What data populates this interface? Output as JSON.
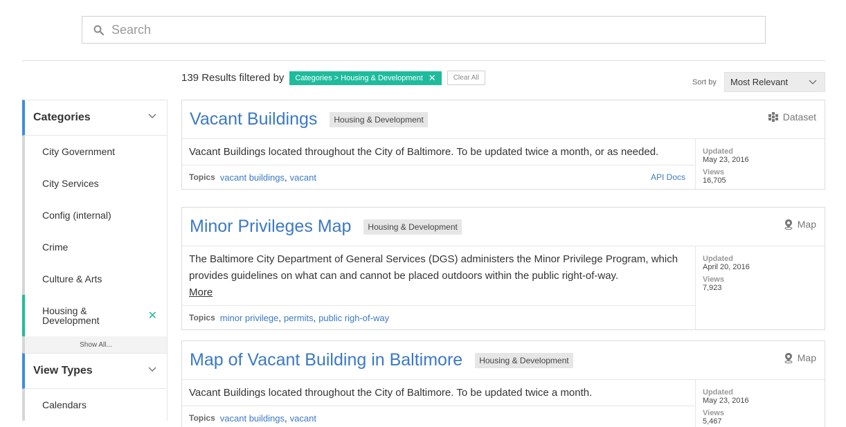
{
  "search": {
    "placeholder": "Search"
  },
  "results": {
    "count_text": "139 Results filtered by",
    "filter_chip": "Categories > Housing & Development",
    "clear_all": "Clear All"
  },
  "sort": {
    "label": "Sort by",
    "selected": "Most Relevant"
  },
  "sidebar": {
    "categories": {
      "title": "Categories",
      "items": [
        "City Government",
        "City Services",
        "Config (internal)",
        "Crime",
        "Culture & Arts"
      ],
      "active_item": "Housing & Development",
      "show_all": "Show All..."
    },
    "view_types": {
      "title": "View Types",
      "items": [
        "Calendars"
      ]
    }
  },
  "cards": [
    {
      "title": "Vacant Buildings",
      "category": "Housing & Development",
      "type": "Dataset",
      "description": "Vacant Buildings located throughout the City of Baltimore. To be updated twice a month, or as needed.",
      "topics_label": "Topics",
      "topics": [
        "vacant buildings",
        "vacant"
      ],
      "api_docs": "API Docs",
      "updated_label": "Updated",
      "updated": "May 23, 2016",
      "views_label": "Views",
      "views": "16,705"
    },
    {
      "title": "Minor Privileges Map",
      "category": "Housing & Development",
      "type": "Map",
      "description": "The Baltimore City Department of General Services (DGS) administers the Minor Privilege Program, which provides guidelines on what can and cannot be placed outdoors within the public right-of-way.",
      "more": "More",
      "topics_label": "Topics",
      "topics": [
        "minor privilege",
        "permits",
        "public righ-of-way"
      ],
      "updated_label": "Updated",
      "updated": "April 20, 2016",
      "views_label": "Views",
      "views": "7,923"
    },
    {
      "title": "Map of Vacant Building in Baltimore",
      "category": "Housing & Development",
      "type": "Map",
      "description": "Vacant Buildings located throughout the City of Baltimore. To be updated twice a month.",
      "topics_label": "Topics",
      "topics": [
        "vacant buildings",
        "vacant"
      ],
      "updated_label": "Updated",
      "updated": "May 23, 2016",
      "views_label": "Views",
      "views": "5,467"
    }
  ]
}
